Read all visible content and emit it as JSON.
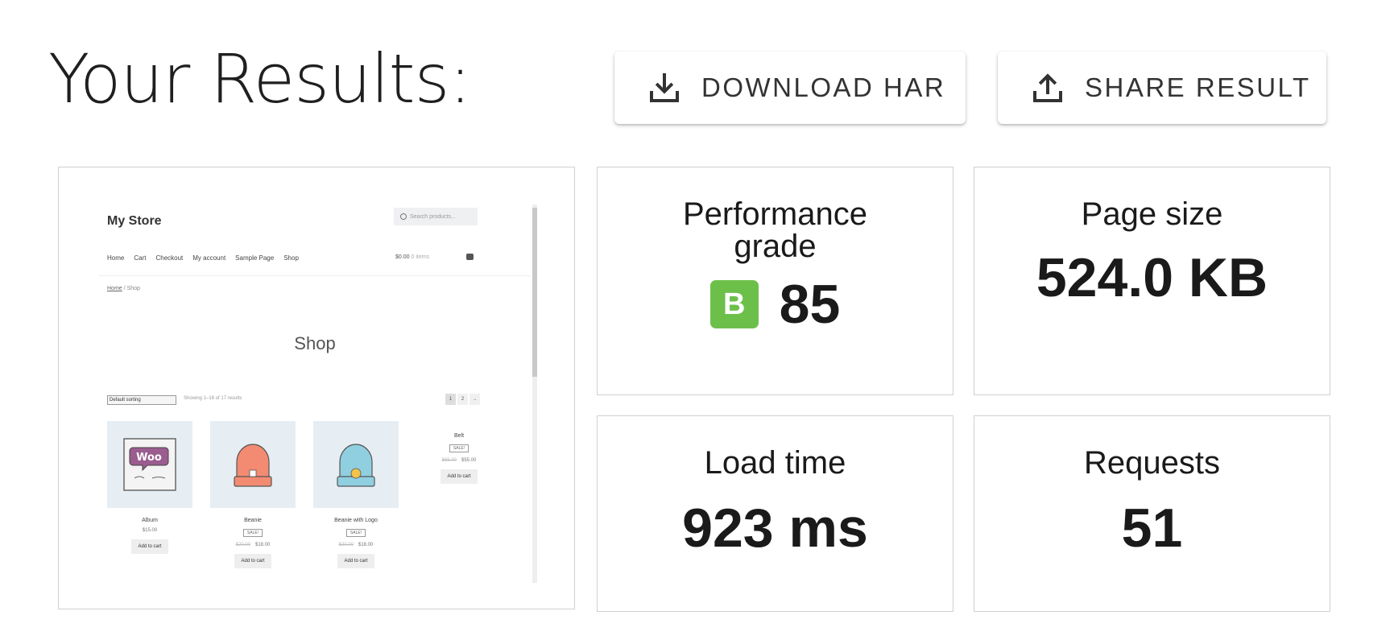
{
  "header": {
    "title": "Your Results:",
    "download_label": "DOWNLOAD HAR",
    "download_icon": "download-icon",
    "share_label": "SHARE RESULT",
    "share_icon": "share-icon"
  },
  "metrics": {
    "performance": {
      "label_line1": "Performance",
      "label_line2": "grade",
      "grade": "B",
      "score": "85",
      "grade_color": "#6cc04a"
    },
    "page_size": {
      "label": "Page size",
      "value": "524.0 KB"
    },
    "load_time": {
      "label": "Load time",
      "value": "923 ms"
    },
    "requests": {
      "label": "Requests",
      "value": "51"
    }
  },
  "preview": {
    "store_name": "My Store",
    "search_placeholder": "Search products...",
    "nav": [
      "Home",
      "Cart",
      "Checkout",
      "My account",
      "Sample Page",
      "Shop"
    ],
    "cart_total": "$0.00",
    "cart_items": "0 items",
    "breadcrumb_home": "Home",
    "breadcrumb_sep": "/",
    "breadcrumb_current": "Shop",
    "page_title": "Shop",
    "sorting": "Default sorting",
    "showing": "Showing 1–16 of 17 results",
    "pages": [
      "1",
      "2",
      "→"
    ],
    "products": [
      {
        "name": "Album",
        "price": "$15.00",
        "old_price": "",
        "sale": "",
        "button": "Add to cart"
      },
      {
        "name": "Beanie",
        "price": "$18.00",
        "old_price": "$20.00",
        "sale": "SALE!",
        "button": "Add to cart"
      },
      {
        "name": "Beanie with Logo",
        "price": "$18.00",
        "old_price": "$20.00",
        "sale": "SALE!",
        "button": "Add to cart"
      },
      {
        "name": "Belt",
        "price": "$55.00",
        "old_price": "$65.00",
        "sale": "SALE!",
        "button": "Add to cart"
      }
    ]
  }
}
